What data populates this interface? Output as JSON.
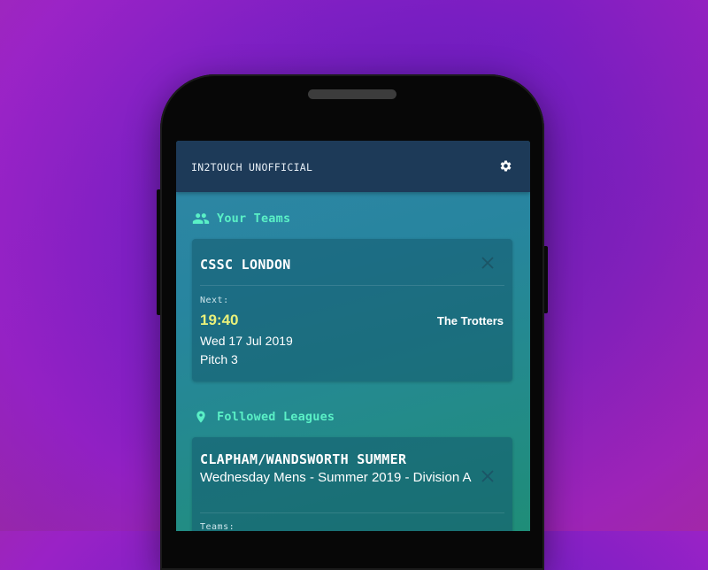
{
  "app": {
    "title": "IN2TOUCH UNOFFICIAL"
  },
  "sections": {
    "teams": {
      "title": "Your Teams",
      "icon": "people-icon"
    },
    "leagues": {
      "title": "Followed Leagues",
      "icon": "location-pin-icon"
    }
  },
  "team_card": {
    "name": "CSSC LONDON",
    "next_label": "Next:",
    "time": "19:40",
    "opponent": "The Trotters",
    "date": "Wed 17 Jul 2019",
    "pitch": "Pitch 3"
  },
  "league_card": {
    "name": "CLAPHAM/WANDSWORTH SUMMER",
    "subtitle": "Wednesday Mens - Summer 2019 - Division A",
    "teams_label": "Teams:"
  },
  "colors": {
    "appbar": "#1d3a58",
    "accent": "#5af0c6",
    "time": "#e9f07a"
  }
}
